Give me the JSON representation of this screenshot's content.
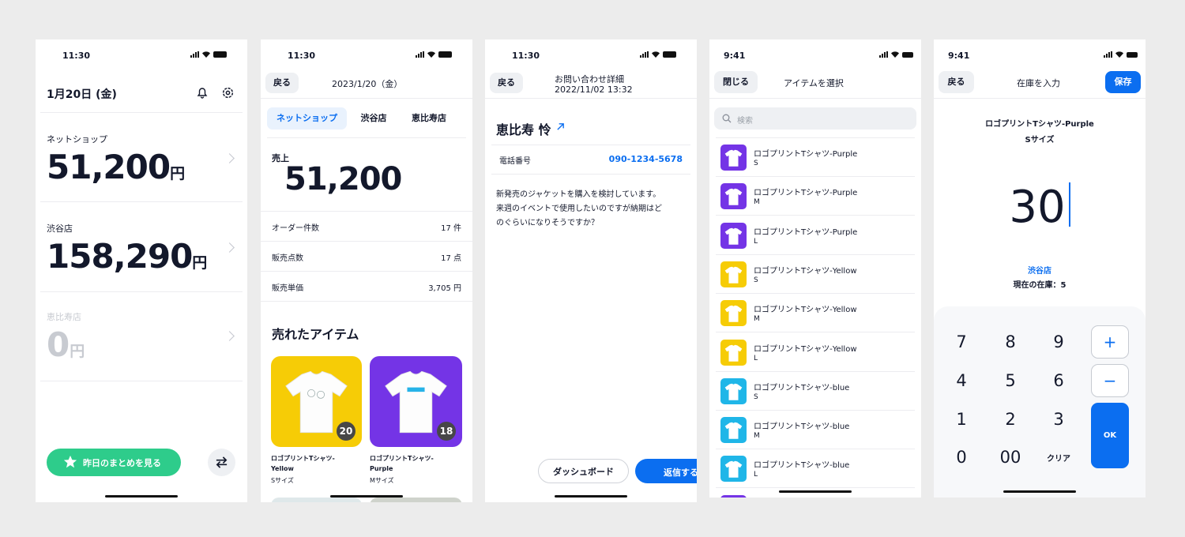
{
  "screen1": {
    "time": "11:30",
    "date": "1月20日 (金)",
    "stores": [
      {
        "name": "ネットショップ",
        "amount": "51,200",
        "unit": "円"
      },
      {
        "name": "渋谷店",
        "amount": "158,290",
        "unit": "円"
      },
      {
        "name": "恵比寿店",
        "amount": "0",
        "unit": "円"
      }
    ],
    "summary_button": "昨日のまとめを見る"
  },
  "screen2": {
    "time": "11:30",
    "back": "戻る",
    "date": "2023/1/20（金）",
    "tabs": [
      "ネットショップ",
      "渋谷店",
      "恵比寿店"
    ],
    "sales_label": "売上",
    "sales_value": "51,200",
    "metrics": [
      {
        "label": "オーダー件数",
        "value": "17 件"
      },
      {
        "label": "販売点数",
        "value": "17 点"
      },
      {
        "label": "販売単価",
        "value": "3,705 円"
      }
    ],
    "sold_title": "売れたアイテム",
    "items": [
      {
        "name": "ロゴプリントTシャツ-Yellow",
        "size": "Sサイズ",
        "count": "20",
        "color": "#f6cc06"
      },
      {
        "name": "ロゴプリントTシャツ-Purple",
        "size": "Mサイズ",
        "count": "18",
        "color": "#7434e6"
      }
    ]
  },
  "screen3": {
    "time": "11:30",
    "back": "戻る",
    "title": "お問い合わせ詳細",
    "datetime": "2022/11/02 13:32",
    "customer": "恵比寿 怜",
    "phone_label": "電話番号",
    "phone": "090-1234-5678",
    "message": [
      "新発売のジャケットを購入を検討しています。",
      "来週のイベントで使用したいのですが納期はど",
      "のぐらいになりそうですか？"
    ],
    "dashboard_button": "ダッシュボード",
    "reply_button": "返信する"
  },
  "screen4": {
    "time": "9:41",
    "close": "閉じる",
    "title": "アイテムを選択",
    "search_placeholder": "検索",
    "items": [
      {
        "name": "ロゴプリントTシャツ-Purple",
        "size": "S",
        "color": "#7434e6"
      },
      {
        "name": "ロゴプリントTシャツ-Purple",
        "size": "M",
        "color": "#7434e6"
      },
      {
        "name": "ロゴプリントTシャツ-Purple",
        "size": "L",
        "color": "#7434e6"
      },
      {
        "name": "ロゴプリントTシャツ-Yellow",
        "size": "S",
        "color": "#f6cc06"
      },
      {
        "name": "ロゴプリントTシャツ-Yellow",
        "size": "M",
        "color": "#f6cc06"
      },
      {
        "name": "ロゴプリントTシャツ-Yellow",
        "size": "L",
        "color": "#f6cc06"
      },
      {
        "name": "ロゴプリントTシャツ-blue",
        "size": "S",
        "color": "#1fb6e8"
      },
      {
        "name": "ロゴプリントTシャツ-blue",
        "size": "M",
        "color": "#1fb6e8"
      },
      {
        "name": "ロゴプリントTシャツ-blue",
        "size": "L",
        "color": "#1fb6e8"
      }
    ]
  },
  "screen5": {
    "time": "9:41",
    "back": "戻る",
    "title": "在庫を入力",
    "save": "保存",
    "product": "ロゴプリントTシャツ-Purple",
    "size": "Sサイズ",
    "value": "30",
    "store": "渋谷店",
    "current_stock": "現在の在庫：5",
    "keys": [
      "7",
      "8",
      "9",
      "4",
      "5",
      "6",
      "1",
      "2",
      "3",
      "0",
      "00",
      "クリア"
    ],
    "plus": "+",
    "minus": "−",
    "ok": "OK"
  },
  "colors": {
    "green": "#2ecc8b",
    "blue": "#0b6ef0",
    "purple": "#7434e6",
    "yellow": "#f6cc06",
    "cyan": "#1fb6e8"
  }
}
